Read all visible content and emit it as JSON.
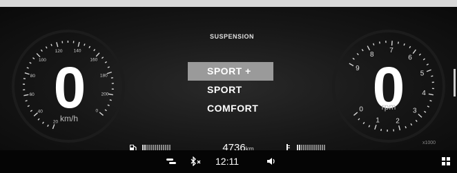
{
  "speedometer": {
    "value": "0",
    "unit": "km/h",
    "ticks": [
      "20",
      "40",
      "60",
      "80",
      "100",
      "120",
      "140",
      "160",
      "180",
      "200",
      "0"
    ]
  },
  "tachometer": {
    "value": "0",
    "unit": "rpm",
    "ticks": [
      "0",
      "1",
      "2",
      "3",
      "4",
      "5",
      "6",
      "7",
      "8",
      "9"
    ],
    "multiplier": "x1000"
  },
  "suspension_menu": {
    "title": "SUSPENSION",
    "options": [
      "SPORT +",
      "SPORT",
      "COMFORT"
    ],
    "selected": "SPORT +"
  },
  "info_bar": {
    "fuel_icon": "fuel-pump-icon",
    "fuel_level": 0.15,
    "odometer_value": "4736",
    "odometer_unit": "km",
    "coolant_icon": "coolant-temperature-icon",
    "coolant_level": 0.15
  },
  "status_bar": {
    "icons": [
      "link-icon",
      "bluetooth-off-icon",
      "volume-icon",
      "apps-grid-icon"
    ],
    "time": "12:11"
  }
}
